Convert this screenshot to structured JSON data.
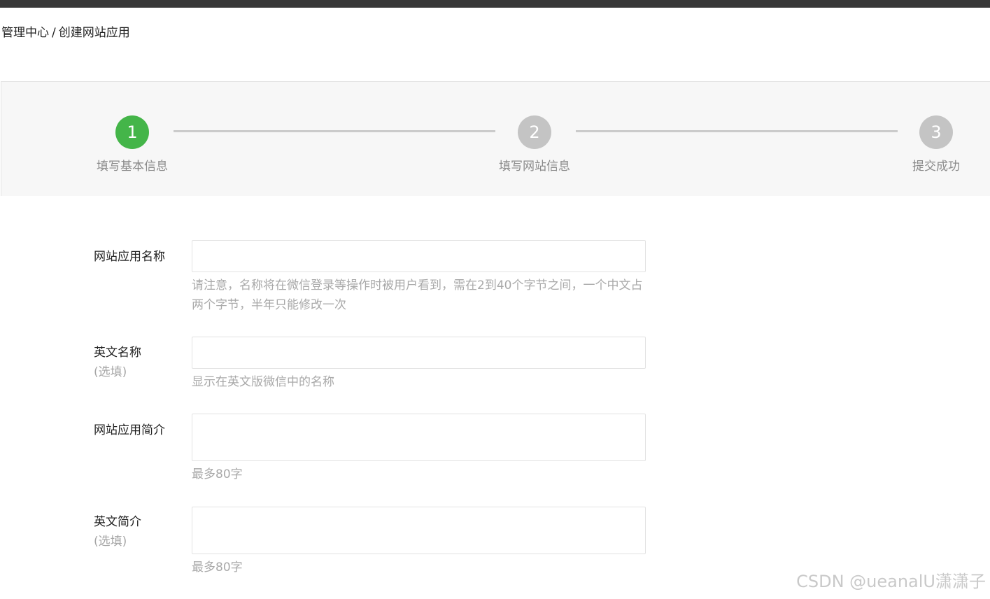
{
  "breadcrumb": {
    "root": "管理中心",
    "separator": "/",
    "current": "创建网站应用"
  },
  "steps": [
    {
      "number": "1",
      "label": "填写基本信息",
      "state": "active"
    },
    {
      "number": "2",
      "label": "填写网站信息",
      "state": "inactive"
    },
    {
      "number": "3",
      "label": "提交成功",
      "state": "inactive"
    }
  ],
  "colors": {
    "active_step": "#44b549",
    "inactive_step": "#c4c4c4",
    "topbar": "#373737"
  },
  "form": {
    "app_name": {
      "label": "网站应用名称",
      "value": "",
      "hint": "请注意，名称将在微信登录等操作时被用户看到，需在2到40个字节之间，一个中文占两个字节，半年只能修改一次"
    },
    "english_name": {
      "label": "英文名称",
      "optional": "(选填)",
      "value": "",
      "hint": "显示在英文版微信中的名称"
    },
    "app_intro": {
      "label": "网站应用简介",
      "value": "",
      "hint": "最多80字"
    },
    "english_intro": {
      "label": "英文简介",
      "optional": "(选填)",
      "value": "",
      "hint": "最多80字"
    }
  },
  "watermark": "CSDN @ueanalU潇潇子"
}
